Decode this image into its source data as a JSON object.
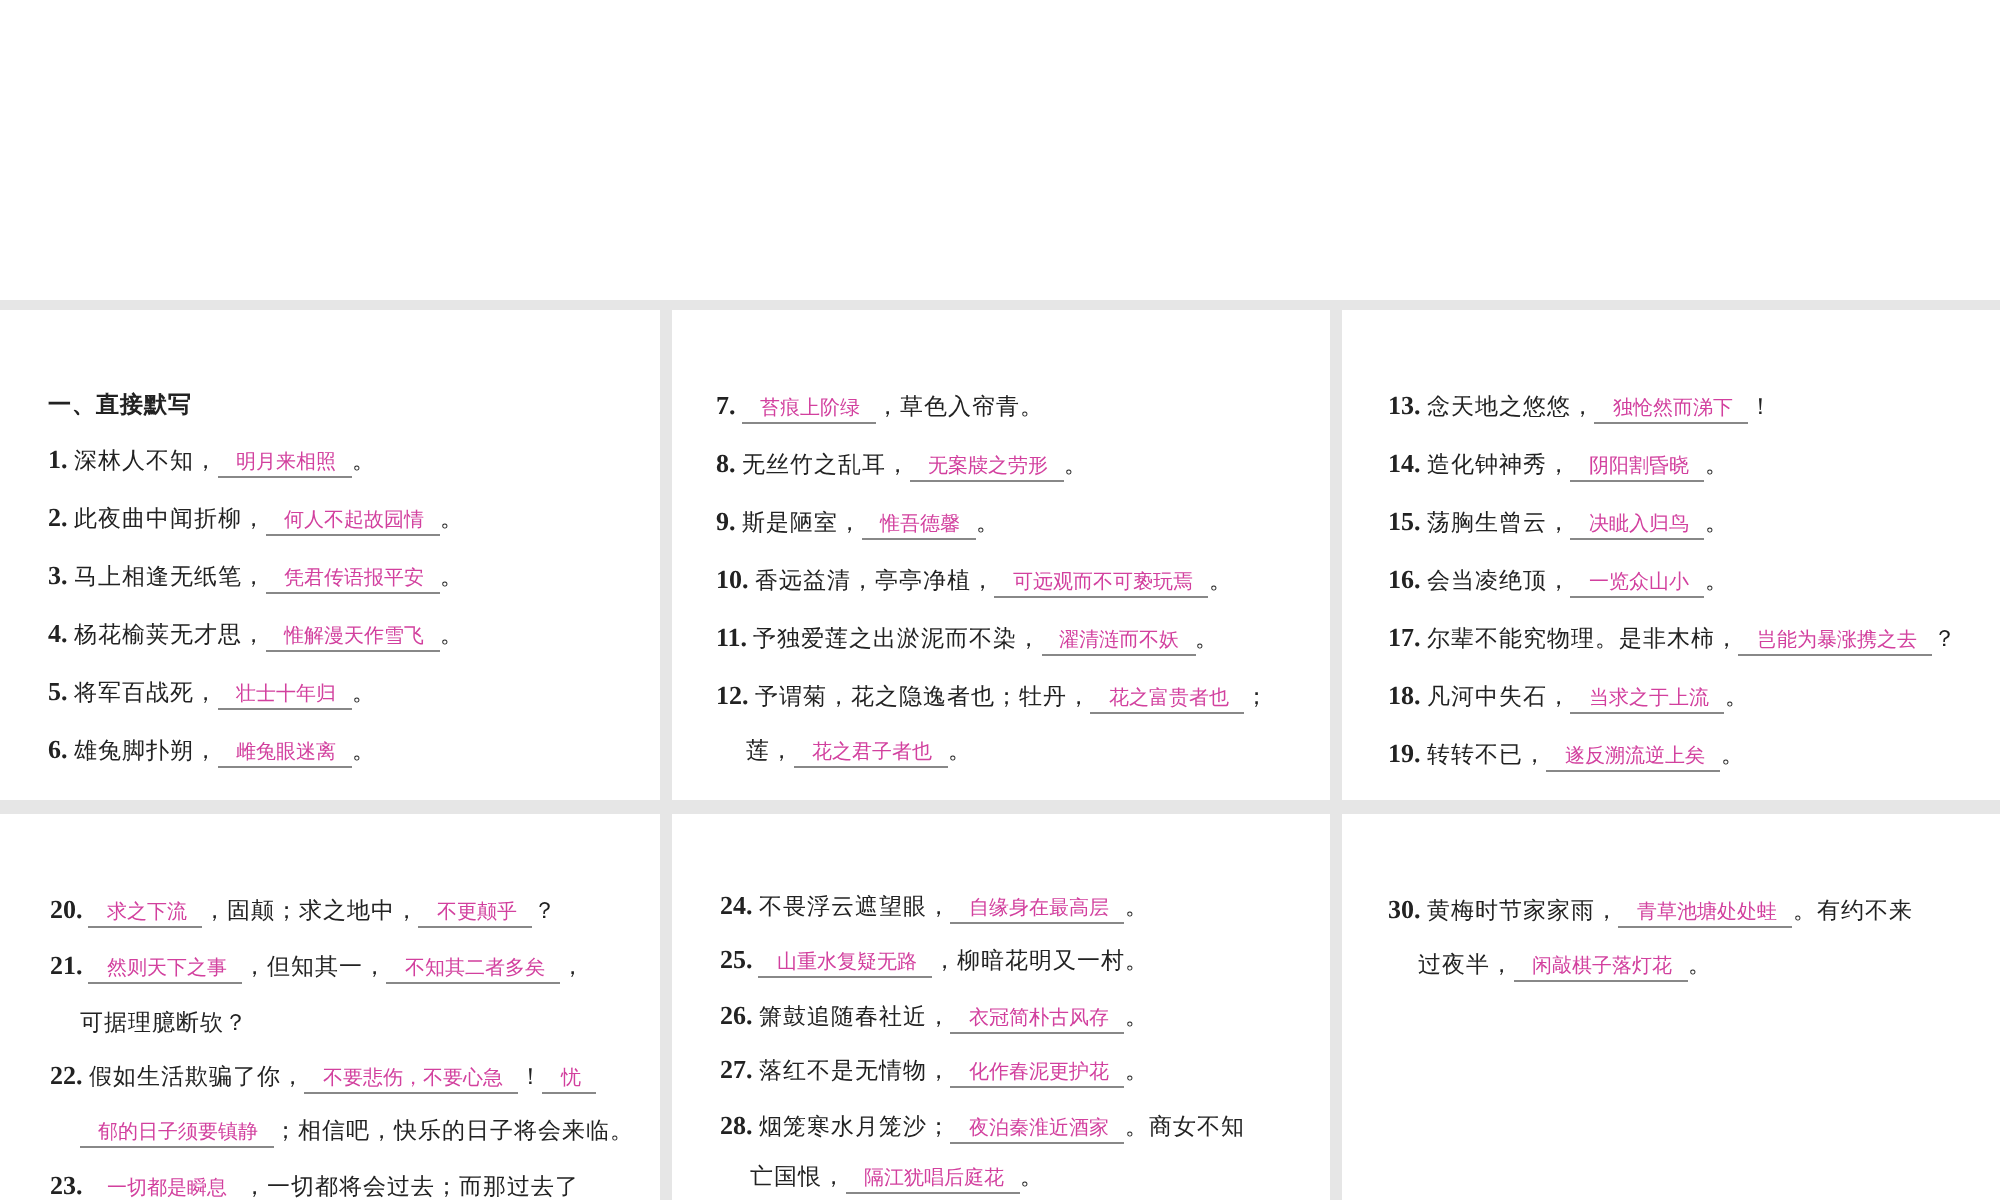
{
  "panels": [
    {
      "heading": "一、直接默写",
      "items": [
        {
          "number": "1.",
          "lines": [
            [
              {
                "kind": "text",
                "text": "深林人不知，"
              },
              {
                "kind": "blank",
                "text": "明月来相照"
              },
              {
                "kind": "text",
                "text": "。"
              }
            ]
          ]
        },
        {
          "number": "2.",
          "lines": [
            [
              {
                "kind": "text",
                "text": "此夜曲中闻折柳，"
              },
              {
                "kind": "blank",
                "text": "何人不起故园情"
              },
              {
                "kind": "text",
                "text": "。"
              }
            ]
          ]
        },
        {
          "number": "3.",
          "lines": [
            [
              {
                "kind": "text",
                "text": "马上相逢无纸笔，"
              },
              {
                "kind": "blank",
                "text": "凭君传语报平安"
              },
              {
                "kind": "text",
                "text": "。"
              }
            ]
          ]
        },
        {
          "number": "4.",
          "lines": [
            [
              {
                "kind": "text",
                "text": "杨花榆荚无才思，"
              },
              {
                "kind": "blank",
                "text": "惟解漫天作雪飞"
              },
              {
                "kind": "text",
                "text": "。"
              }
            ]
          ]
        },
        {
          "number": "5.",
          "lines": [
            [
              {
                "kind": "text",
                "text": "将军百战死，"
              },
              {
                "kind": "blank",
                "text": "壮士十年归"
              },
              {
                "kind": "text",
                "text": "。"
              }
            ]
          ]
        },
        {
          "number": "6.",
          "lines": [
            [
              {
                "kind": "text",
                "text": "雄兔脚扑朔，"
              },
              {
                "kind": "blank",
                "text": "雌兔眼迷离"
              },
              {
                "kind": "text",
                "text": "。"
              }
            ]
          ]
        }
      ]
    },
    {
      "items": [
        {
          "number": "7.",
          "lines": [
            [
              {
                "kind": "blank",
                "text": "苔痕上阶绿"
              },
              {
                "kind": "text",
                "text": "，草色入帘青。"
              }
            ]
          ]
        },
        {
          "number": "8.",
          "lines": [
            [
              {
                "kind": "text",
                "text": "无丝竹之乱耳，"
              },
              {
                "kind": "blank",
                "text": "无案牍之劳形"
              },
              {
                "kind": "text",
                "text": "。"
              }
            ]
          ]
        },
        {
          "number": "9.",
          "lines": [
            [
              {
                "kind": "text",
                "text": "斯是陋室，"
              },
              {
                "kind": "blank",
                "text": "惟吾德馨"
              },
              {
                "kind": "text",
                "text": "。"
              }
            ]
          ]
        },
        {
          "number": "10.",
          "lines": [
            [
              {
                "kind": "text",
                "text": "香远益清，亭亭净植，"
              },
              {
                "kind": "blank",
                "text": "可远观而不可亵玩焉"
              },
              {
                "kind": "text",
                "text": "。"
              }
            ]
          ]
        },
        {
          "number": "11.",
          "lines": [
            [
              {
                "kind": "text",
                "text": "予独爱莲之出淤泥而不染，"
              },
              {
                "kind": "blank",
                "text": "濯清涟而不妖"
              },
              {
                "kind": "text",
                "text": "。"
              }
            ]
          ]
        },
        {
          "number": "12.",
          "lines": [
            [
              {
                "kind": "text",
                "text": "予谓菊，花之隐逸者也；牡丹，"
              },
              {
                "kind": "blank",
                "text": "花之富贵者也"
              },
              {
                "kind": "text",
                "text": "；"
              }
            ],
            [
              {
                "kind": "text",
                "text": "莲，"
              },
              {
                "kind": "blank",
                "text": "花之君子者也"
              },
              {
                "kind": "text",
                "text": "。"
              }
            ]
          ]
        }
      ]
    },
    {
      "items": [
        {
          "number": "13.",
          "lines": [
            [
              {
                "kind": "text",
                "text": "念天地之悠悠，"
              },
              {
                "kind": "blank",
                "text": "独怆然而涕下"
              },
              {
                "kind": "text",
                "text": "！"
              }
            ]
          ]
        },
        {
          "number": "14.",
          "lines": [
            [
              {
                "kind": "text",
                "text": "造化钟神秀，"
              },
              {
                "kind": "blank",
                "text": "阴阳割昏晓"
              },
              {
                "kind": "text",
                "text": "。"
              }
            ]
          ]
        },
        {
          "number": "15.",
          "lines": [
            [
              {
                "kind": "text",
                "text": "荡胸生曾云，"
              },
              {
                "kind": "blank",
                "text": "决眦入归鸟"
              },
              {
                "kind": "text",
                "text": "。"
              }
            ]
          ]
        },
        {
          "number": "16.",
          "lines": [
            [
              {
                "kind": "text",
                "text": "会当凌绝顶，"
              },
              {
                "kind": "blank",
                "text": "一览众山小"
              },
              {
                "kind": "text",
                "text": "。"
              }
            ]
          ]
        },
        {
          "number": "17.",
          "lines": [
            [
              {
                "kind": "text",
                "text": "尔辈不能究物理。是非木柿，"
              },
              {
                "kind": "blank",
                "text": "岂能为暴涨携之去"
              },
              {
                "kind": "text",
                "text": "？"
              }
            ]
          ]
        },
        {
          "number": "18.",
          "lines": [
            [
              {
                "kind": "text",
                "text": "凡河中失石，"
              },
              {
                "kind": "blank",
                "text": "当求之于上流"
              },
              {
                "kind": "text",
                "text": "。"
              }
            ]
          ]
        },
        {
          "number": "19.",
          "lines": [
            [
              {
                "kind": "text",
                "text": "转转不已，"
              },
              {
                "kind": "blank",
                "text": "遂反溯流逆上矣"
              },
              {
                "kind": "text",
                "text": "。"
              }
            ]
          ]
        }
      ]
    },
    {
      "items": [
        {
          "number": "20.",
          "lines": [
            [
              {
                "kind": "blank",
                "text": "求之下流"
              },
              {
                "kind": "text",
                "text": "，固颠；求之地中，"
              },
              {
                "kind": "blank",
                "text": "不更颠乎"
              },
              {
                "kind": "text",
                "text": "？"
              }
            ]
          ]
        },
        {
          "number": "21.",
          "lines": [
            [
              {
                "kind": "blank",
                "text": "然则天下之事"
              },
              {
                "kind": "text",
                "text": "，但知其一，"
              },
              {
                "kind": "blank",
                "text": "不知其二者多矣"
              },
              {
                "kind": "text",
                "text": "，"
              }
            ],
            [
              {
                "kind": "text",
                "text": "可据理臆断欤？"
              }
            ]
          ]
        },
        {
          "number": "22.",
          "lines": [
            [
              {
                "kind": "text",
                "text": "假如生活欺骗了你，"
              },
              {
                "kind": "blank",
                "text": "不要悲伤，不要心急"
              },
              {
                "kind": "text",
                "text": "！"
              },
              {
                "kind": "blank",
                "text": "忧"
              }
            ],
            [
              {
                "kind": "blank",
                "text": "郁的日子须要镇静"
              },
              {
                "kind": "text",
                "text": "；相信吧，快乐的日子将会来临。"
              }
            ]
          ]
        },
        {
          "number": "23.",
          "lines": [
            [
              {
                "kind": "blank",
                "text": "一切都是瞬息"
              },
              {
                "kind": "text",
                "text": "，一切都将会过去；而那过去了"
              }
            ]
          ]
        }
      ]
    },
    {
      "items": [
        {
          "number": "24.",
          "lines": [
            [
              {
                "kind": "text",
                "text": "不畏浮云遮望眼，"
              },
              {
                "kind": "blank",
                "text": "自缘身在最高层"
              },
              {
                "kind": "text",
                "text": "。"
              }
            ]
          ]
        },
        {
          "number": "25.",
          "lines": [
            [
              {
                "kind": "blank",
                "text": "山重水复疑无路"
              },
              {
                "kind": "text",
                "text": "，柳暗花明又一村。"
              }
            ]
          ]
        },
        {
          "number": "26.",
          "lines": [
            [
              {
                "kind": "text",
                "text": "箫鼓追随春社近，"
              },
              {
                "kind": "blank",
                "text": "衣冠简朴古风存"
              },
              {
                "kind": "text",
                "text": "。"
              }
            ]
          ]
        },
        {
          "number": "27.",
          "lines": [
            [
              {
                "kind": "text",
                "text": "落红不是无情物，"
              },
              {
                "kind": "blank",
                "text": "化作春泥更护花"
              },
              {
                "kind": "text",
                "text": "。"
              }
            ]
          ]
        },
        {
          "number": "28.",
          "lines": [
            [
              {
                "kind": "text",
                "text": "烟笼寒水月笼沙；"
              },
              {
                "kind": "blank",
                "text": "夜泊秦淮近酒家"
              },
              {
                "kind": "text",
                "text": "。商女不知"
              }
            ],
            [
              {
                "kind": "text",
                "text": "亡国恨，"
              },
              {
                "kind": "blank",
                "text": "隔江犹唱后庭花"
              },
              {
                "kind": "text",
                "text": "。"
              }
            ]
          ]
        }
      ]
    },
    {
      "items": [
        {
          "number": "30.",
          "lines": [
            [
              {
                "kind": "text",
                "text": "黄梅时节家家雨，"
              },
              {
                "kind": "blank",
                "text": "青草池塘处处蛙"
              },
              {
                "kind": "text",
                "text": "。有约不来"
              }
            ],
            [
              {
                "kind": "text",
                "text": "过夜半，"
              },
              {
                "kind": "blank",
                "text": "闲敲棋子落灯花"
              },
              {
                "kind": "text",
                "text": "。"
              }
            ]
          ]
        }
      ]
    }
  ]
}
